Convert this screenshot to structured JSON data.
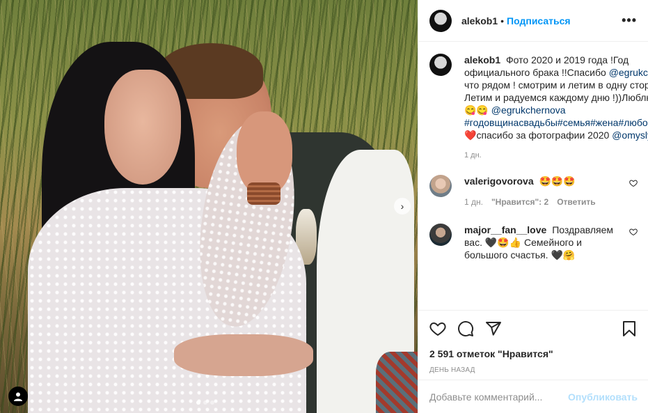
{
  "post": {
    "username": "alekob1",
    "follow_label": "Подписаться",
    "header_separator": "•",
    "more_icon": "more-horizontal-icon",
    "caption": {
      "text_1": "Фото 2020 и 2019 года !Год официального брака !!Спасибо",
      "mention_1": "@egrukchernova",
      "text_2": "что рядом ! смотрим и летим в одну сторону ! Летим и радуемся каждому дню !))Люблю",
      "emoji_1": "🏆❤️🍾😋😋",
      "mention_2": "@egrukchernova",
      "hashtags": "#годовщинасвадьбы#семья#жена#любовьморковь",
      "heart": "❤️",
      "text_3": "спасибо за фотографии 2020",
      "mention_3": "@omyslyvyy",
      "time": "1 дн."
    },
    "comments": [
      {
        "username": "valerigovorova",
        "text": "🤩🤩🤩",
        "time": "1 дн.",
        "likes": "\"Нравится\": 2",
        "reply_label": "Ответить",
        "like_icon": "heart-outline-icon"
      },
      {
        "username": "major__fan__love",
        "text": "Поздравляем вас. 🖤🤩👍 Семейного и большого счастья. 🖤🤗",
        "like_icon": "heart-outline-icon"
      }
    ],
    "likes_count": "2 591 отметок \"Нравится\"",
    "posted": "день назад",
    "comment_placeholder": "Добавьте комментарий...",
    "publish_label": "Опубликовать",
    "next_icon": "chevron-right-icon",
    "tag_icon": "person-tag-icon",
    "carousel": {
      "count": 3,
      "active_index": 0
    }
  },
  "colors": {
    "accent": "#0095f6",
    "link": "#00376b",
    "muted": "#8e8e8e",
    "publish_disabled": "#b2dffc",
    "like_red": "#ed4956"
  }
}
